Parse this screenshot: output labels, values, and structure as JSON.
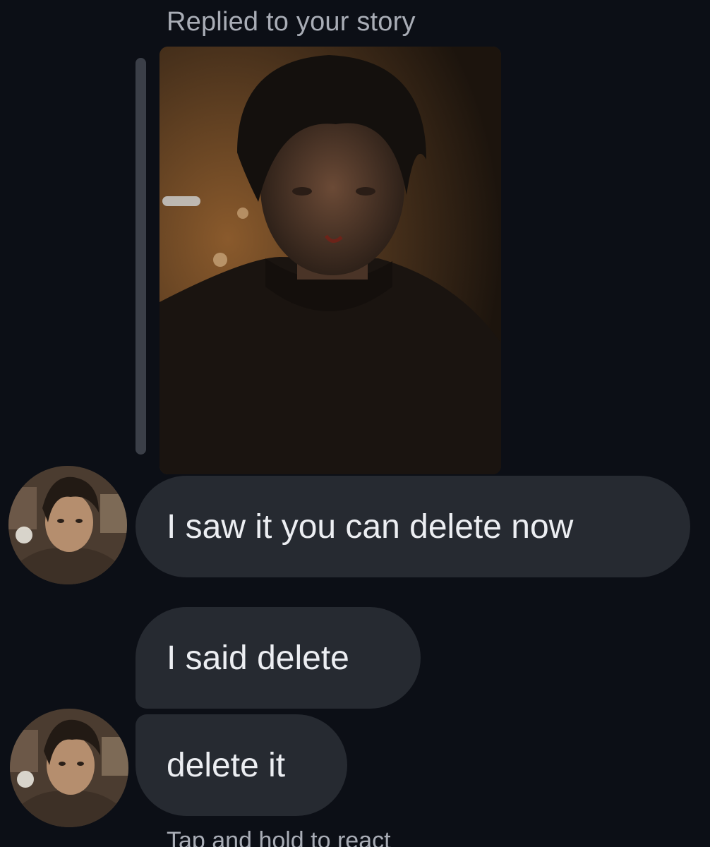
{
  "story_reply": {
    "header": "Replied to your story"
  },
  "messages": [
    {
      "text": "I saw it you can delete now"
    },
    {
      "text": "I said delete"
    },
    {
      "text": "delete it"
    }
  ],
  "footer": {
    "hint": "Tap and hold to react"
  },
  "colors": {
    "background": "#0c0f16",
    "bubble": "#262a31",
    "secondary_text": "#a9adb6",
    "primary_text": "#eceef2"
  }
}
